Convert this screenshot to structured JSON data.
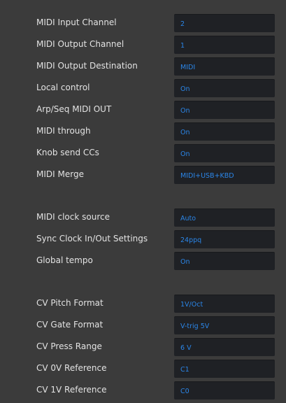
{
  "settings": [
    {
      "label": "MIDI Input Channel",
      "value": "2"
    },
    {
      "label": "MIDI Output Channel",
      "value": "1"
    },
    {
      "label": "MIDI Output Destination",
      "value": "MIDI"
    },
    {
      "label": "Local control",
      "value": "On"
    },
    {
      "label": "Arp/Seq MIDI OUT",
      "value": "On"
    },
    {
      "label": "MIDI through",
      "value": "On"
    },
    {
      "label": "Knob send CCs",
      "value": "On"
    },
    {
      "label": "MIDI Merge",
      "value": "MIDI+USB+KBD"
    },
    {
      "label": "MIDI clock source",
      "value": "Auto"
    },
    {
      "label": "Sync Clock In/Out Settings",
      "value": "24ppq"
    },
    {
      "label": "Global tempo",
      "value": "On"
    },
    {
      "label": "CV Pitch Format",
      "value": "1V/Oct"
    },
    {
      "label": "CV Gate Format",
      "value": "V-trig 5V"
    },
    {
      "label": "CV Press Range",
      "value": "6 V"
    },
    {
      "label": "CV 0V Reference",
      "value": "C1"
    },
    {
      "label": "CV 1V Reference",
      "value": "C0"
    }
  ],
  "colors": {
    "background": "#3b3b3b",
    "label_text": "#e3e3e3",
    "field_background": "#1f2125",
    "value_text": "#2b86e8"
  }
}
